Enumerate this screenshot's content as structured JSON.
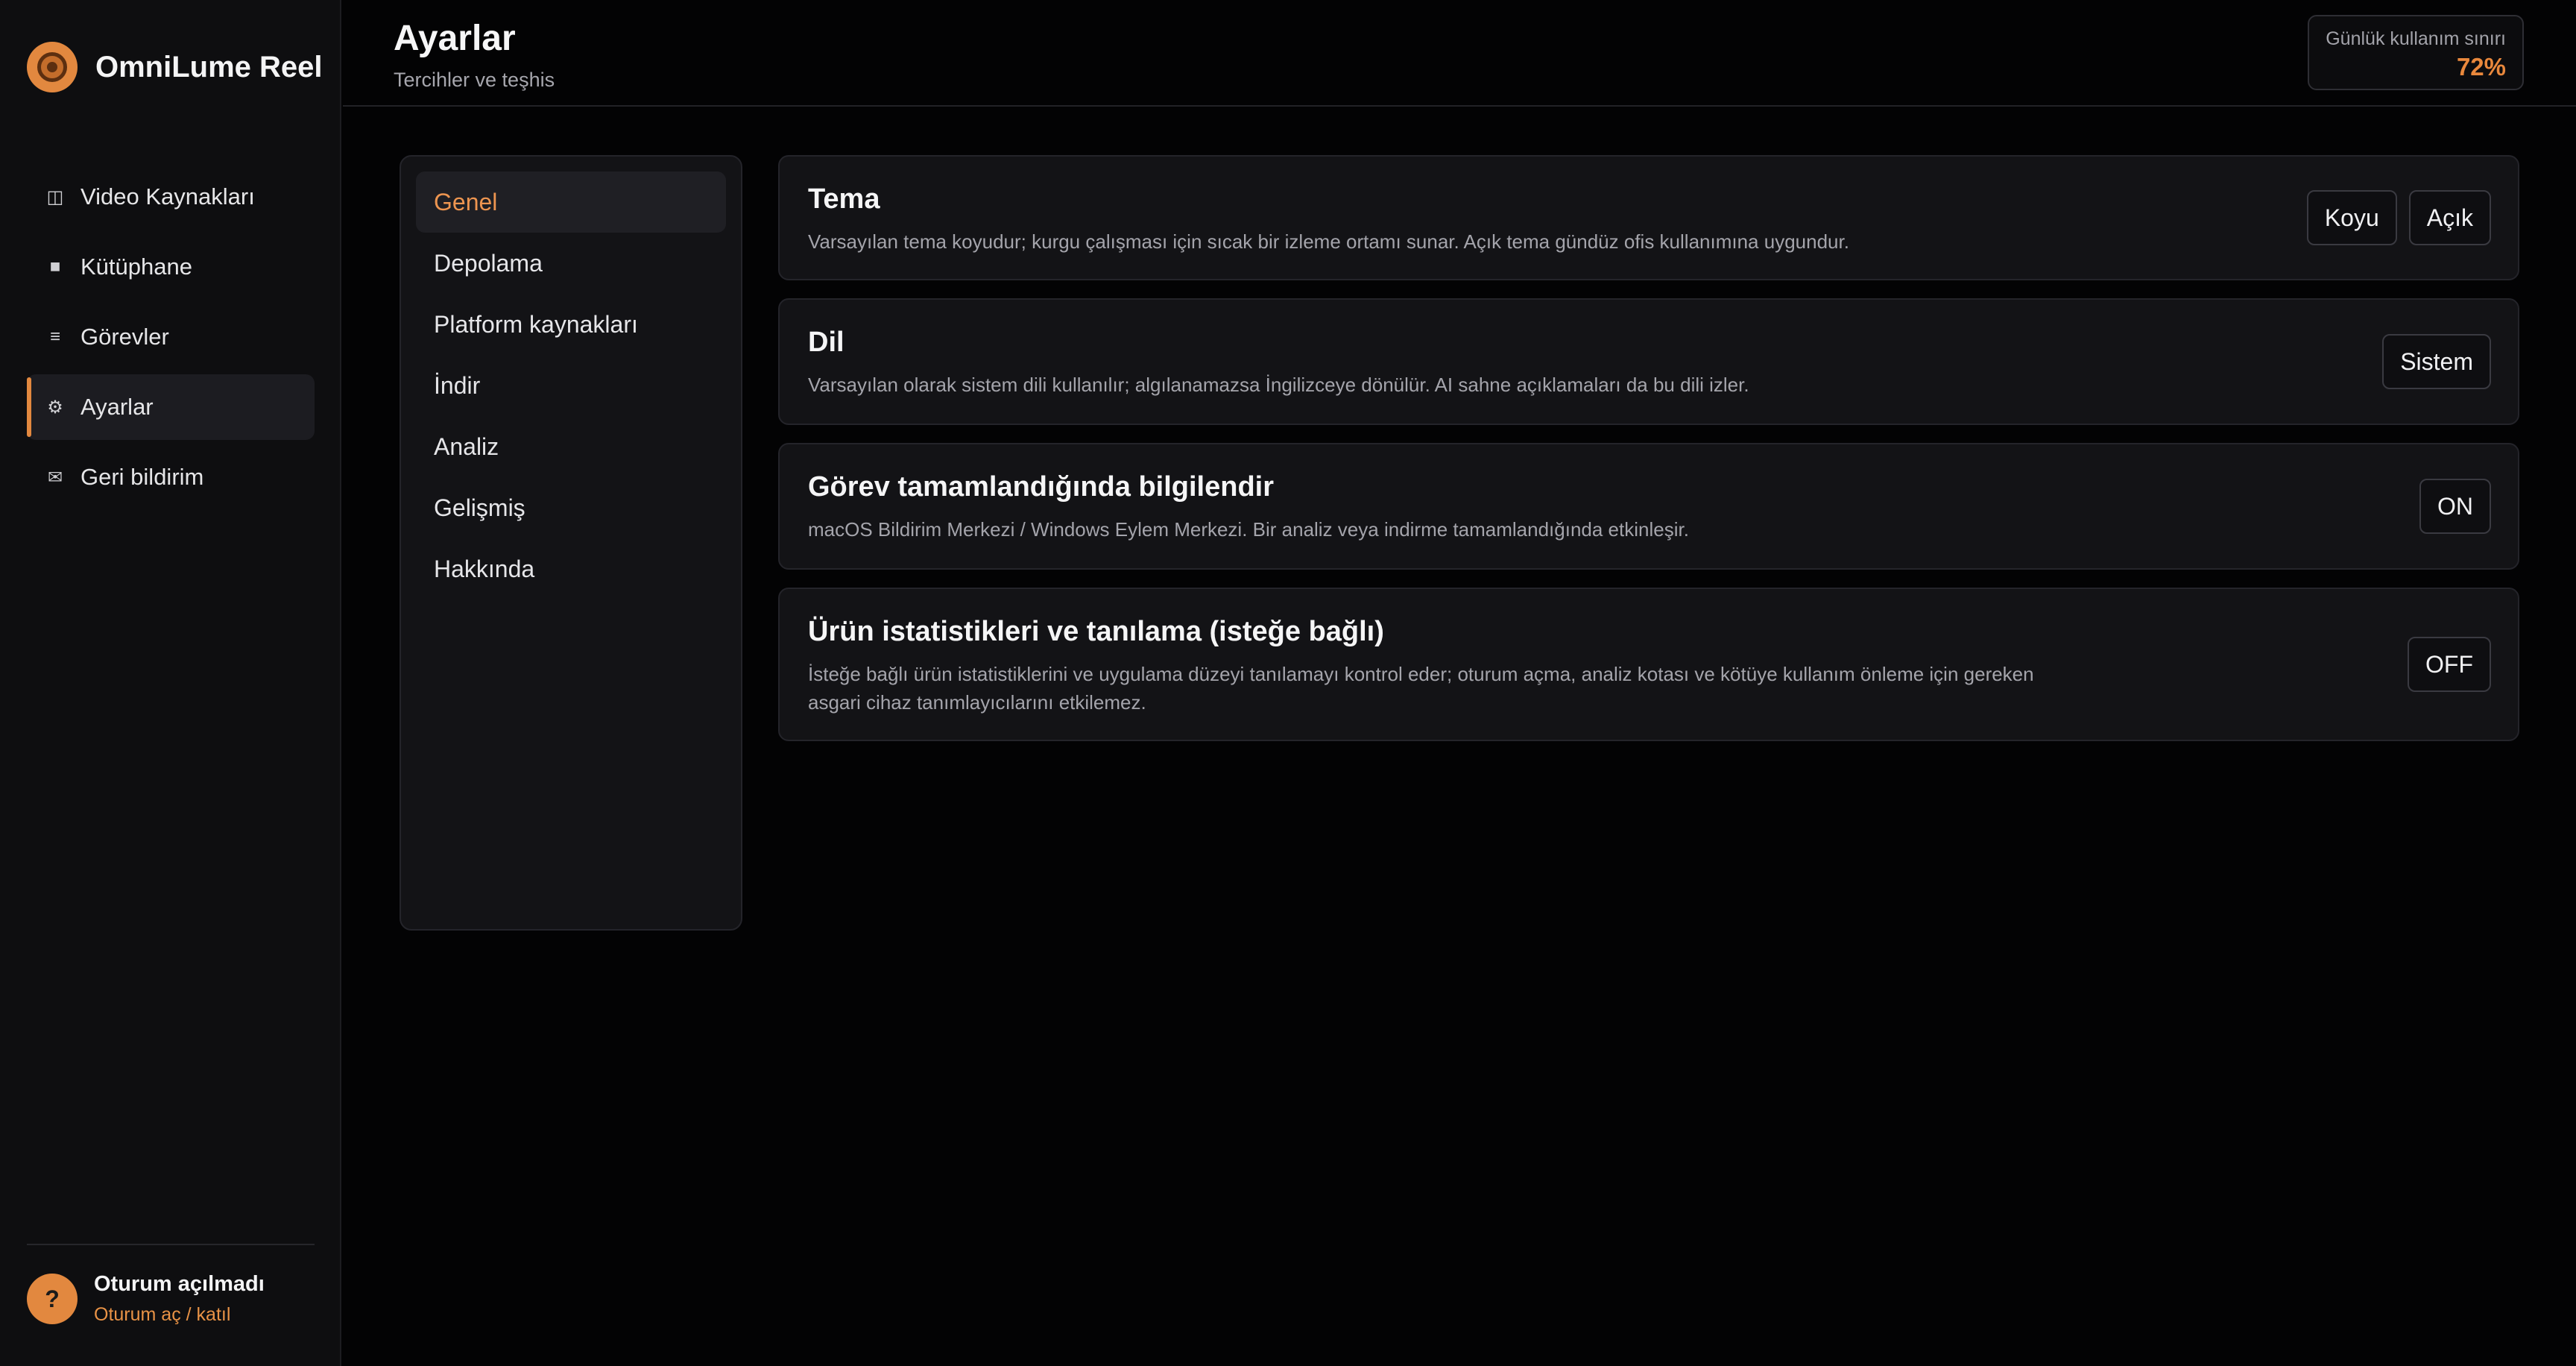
{
  "brand": {
    "name": "OmniLume Reel"
  },
  "nav": {
    "items": [
      {
        "label": "Video Kaynakları",
        "icon": "columns-icon",
        "glyph": "◫"
      },
      {
        "label": "Kütüphane",
        "icon": "library-icon",
        "glyph": "■"
      },
      {
        "label": "Görevler",
        "icon": "list-icon",
        "glyph": "≡"
      },
      {
        "label": "Ayarlar",
        "icon": "gear-icon",
        "glyph": "⚙"
      },
      {
        "label": "Geri bildirim",
        "icon": "mail-icon",
        "glyph": "✉"
      }
    ],
    "active_index": 3
  },
  "account": {
    "avatar_glyph": "?",
    "name": "Oturum açılmadı",
    "link": "Oturum aç / katıl"
  },
  "header": {
    "title": "Ayarlar",
    "subtitle": "Tercihler ve teşhis",
    "usage": {
      "label": "Günlük kullanım sınırı",
      "value": "72%"
    }
  },
  "submenu": {
    "items": [
      "Genel",
      "Depolama",
      "Platform kaynakları",
      "İndir",
      "Analiz",
      "Gelişmiş",
      "Hakkında"
    ],
    "active_index": 0
  },
  "cards": [
    {
      "title": "Tema",
      "description": "Varsayılan tema koyudur; kurgu çalışması için sıcak bir izleme ortamı sunar. Açık tema gündüz ofis kullanımına uygundur.",
      "buttons": [
        "Koyu",
        "Açık"
      ]
    },
    {
      "title": "Dil",
      "description": "Varsayılan olarak sistem dili kullanılır; algılanamazsa İngilizceye dönülür. AI sahne açıklamaları da bu dili izler.",
      "buttons": [
        "Sistem"
      ]
    },
    {
      "title": "Görev tamamlandığında bilgilendir",
      "description": "macOS Bildirim Merkezi / Windows Eylem Merkezi. Bir analiz veya indirme tamamlandığında etkinleşir.",
      "buttons": [
        "ON"
      ]
    },
    {
      "title": "Ürün istatistikleri ve tanılama (isteğe bağlı)",
      "description": "İsteğe bağlı ürün istatistiklerini ve uygulama düzeyi tanılamayı kontrol eder; oturum açma, analiz kotası ve kötüye kullanım önleme için gereken asgari cihaz tanımlayıcılarını etkilemez.",
      "buttons": [
        "OFF"
      ]
    }
  ],
  "colors": {
    "accent": "#e2883f",
    "background": "#030304",
    "panel": "#131316",
    "sidebar": "#0e0e10"
  }
}
